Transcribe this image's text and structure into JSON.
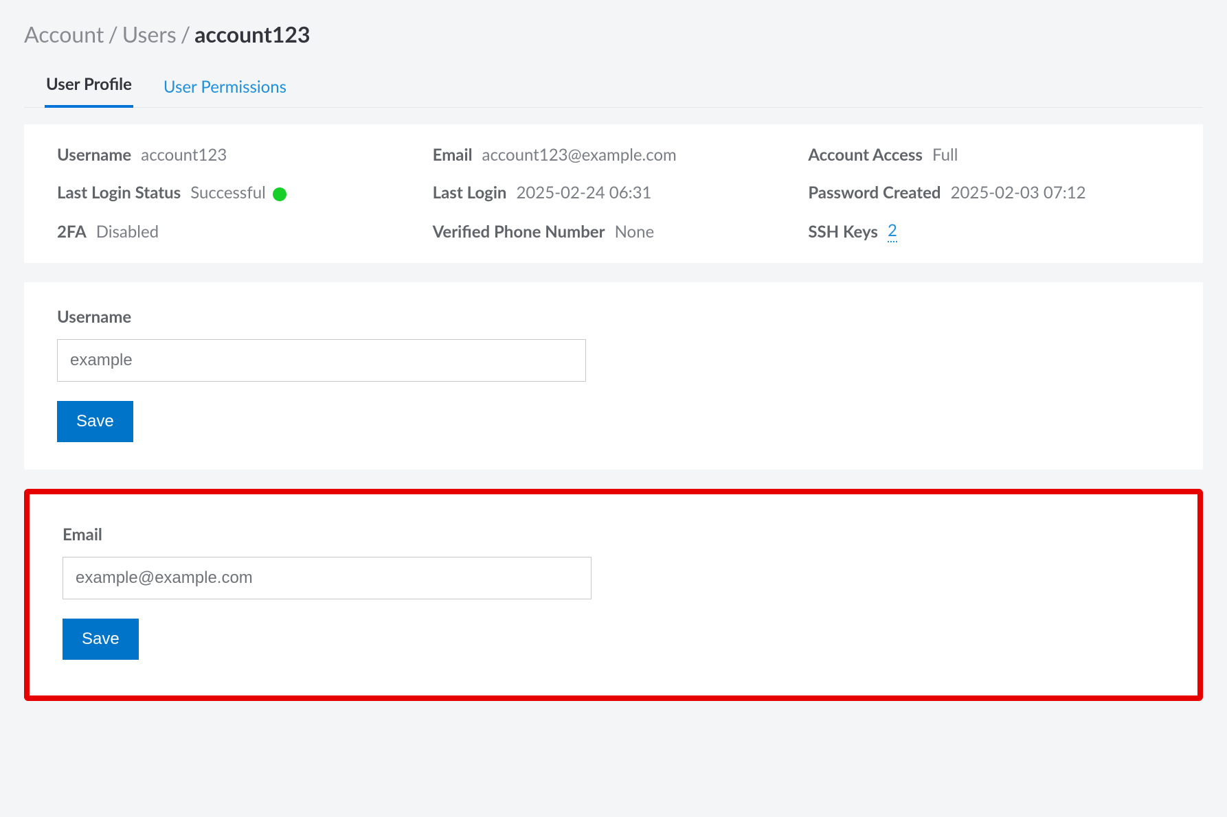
{
  "breadcrumb": {
    "lvl1": "Account",
    "lvl2": "Users",
    "current": "account123"
  },
  "tabs": {
    "profile": "User Profile",
    "permissions": "User Permissions"
  },
  "info": {
    "username_label": "Username",
    "username_value": "account123",
    "email_label": "Email",
    "email_value": "account123@example.com",
    "access_label": "Account Access",
    "access_value": "Full",
    "last_login_status_label": "Last Login Status",
    "last_login_status_value": "Successful",
    "last_login_label": "Last Login",
    "last_login_value": "2025-02-24 06:31",
    "password_created_label": "Password Created",
    "password_created_value": "2025-02-03 07:12",
    "tfa_label": "2FA",
    "tfa_value": "Disabled",
    "phone_label": "Verified Phone Number",
    "phone_value": "None",
    "ssh_label": "SSH Keys",
    "ssh_value": "2"
  },
  "forms": {
    "username": {
      "label": "Username",
      "value": "example",
      "save": "Save"
    },
    "email": {
      "label": "Email",
      "value": "example@example.com",
      "save": "Save"
    }
  }
}
